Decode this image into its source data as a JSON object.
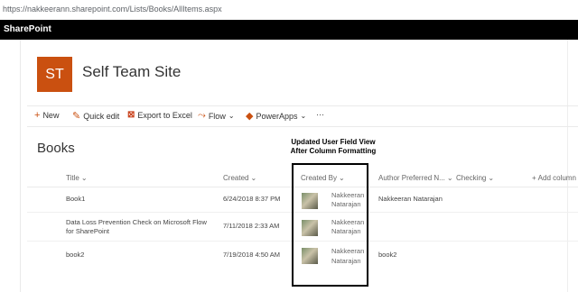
{
  "browser": {
    "url": "https://nakkeerann.sharepoint.com/Lists/Books/AllItems.aspx"
  },
  "suite": {
    "brand": "SharePoint"
  },
  "site": {
    "logo_text": "ST",
    "logo_color": "#ca5010",
    "title": "Self Team Site"
  },
  "commands": {
    "new": "New",
    "quick_edit": "Quick edit",
    "export": "Export to Excel",
    "flow": "Flow",
    "powerapps": "PowerApps",
    "more": "···"
  },
  "list": {
    "title": "Books",
    "columns": {
      "title": "Title",
      "created": "Created",
      "created_by": "Created By",
      "author": "Author Preferred N...",
      "checking": "Checking",
      "add": "Add column"
    },
    "rows": [
      {
        "title": "Book1",
        "created": "6/24/2018 8:37 PM",
        "created_by": [
          "Nakkeeran",
          "Natarajan"
        ],
        "author": "Nakkeeran Natarajan"
      },
      {
        "title": "Data Loss Prevention Check on Microsoft Flow for SharePoint",
        "created": "7/11/2018 2:33 AM",
        "created_by": [
          "Nakkeeran",
          "Natarajan"
        ],
        "author": ""
      },
      {
        "title": "book2",
        "created": "7/19/2018 4:50 AM",
        "created_by": [
          "Nakkeeran",
          "Natarajan"
        ],
        "author": "book2"
      }
    ]
  },
  "annotation": {
    "line1": "Updated User Field View",
    "line2": "After Column Formatting"
  }
}
